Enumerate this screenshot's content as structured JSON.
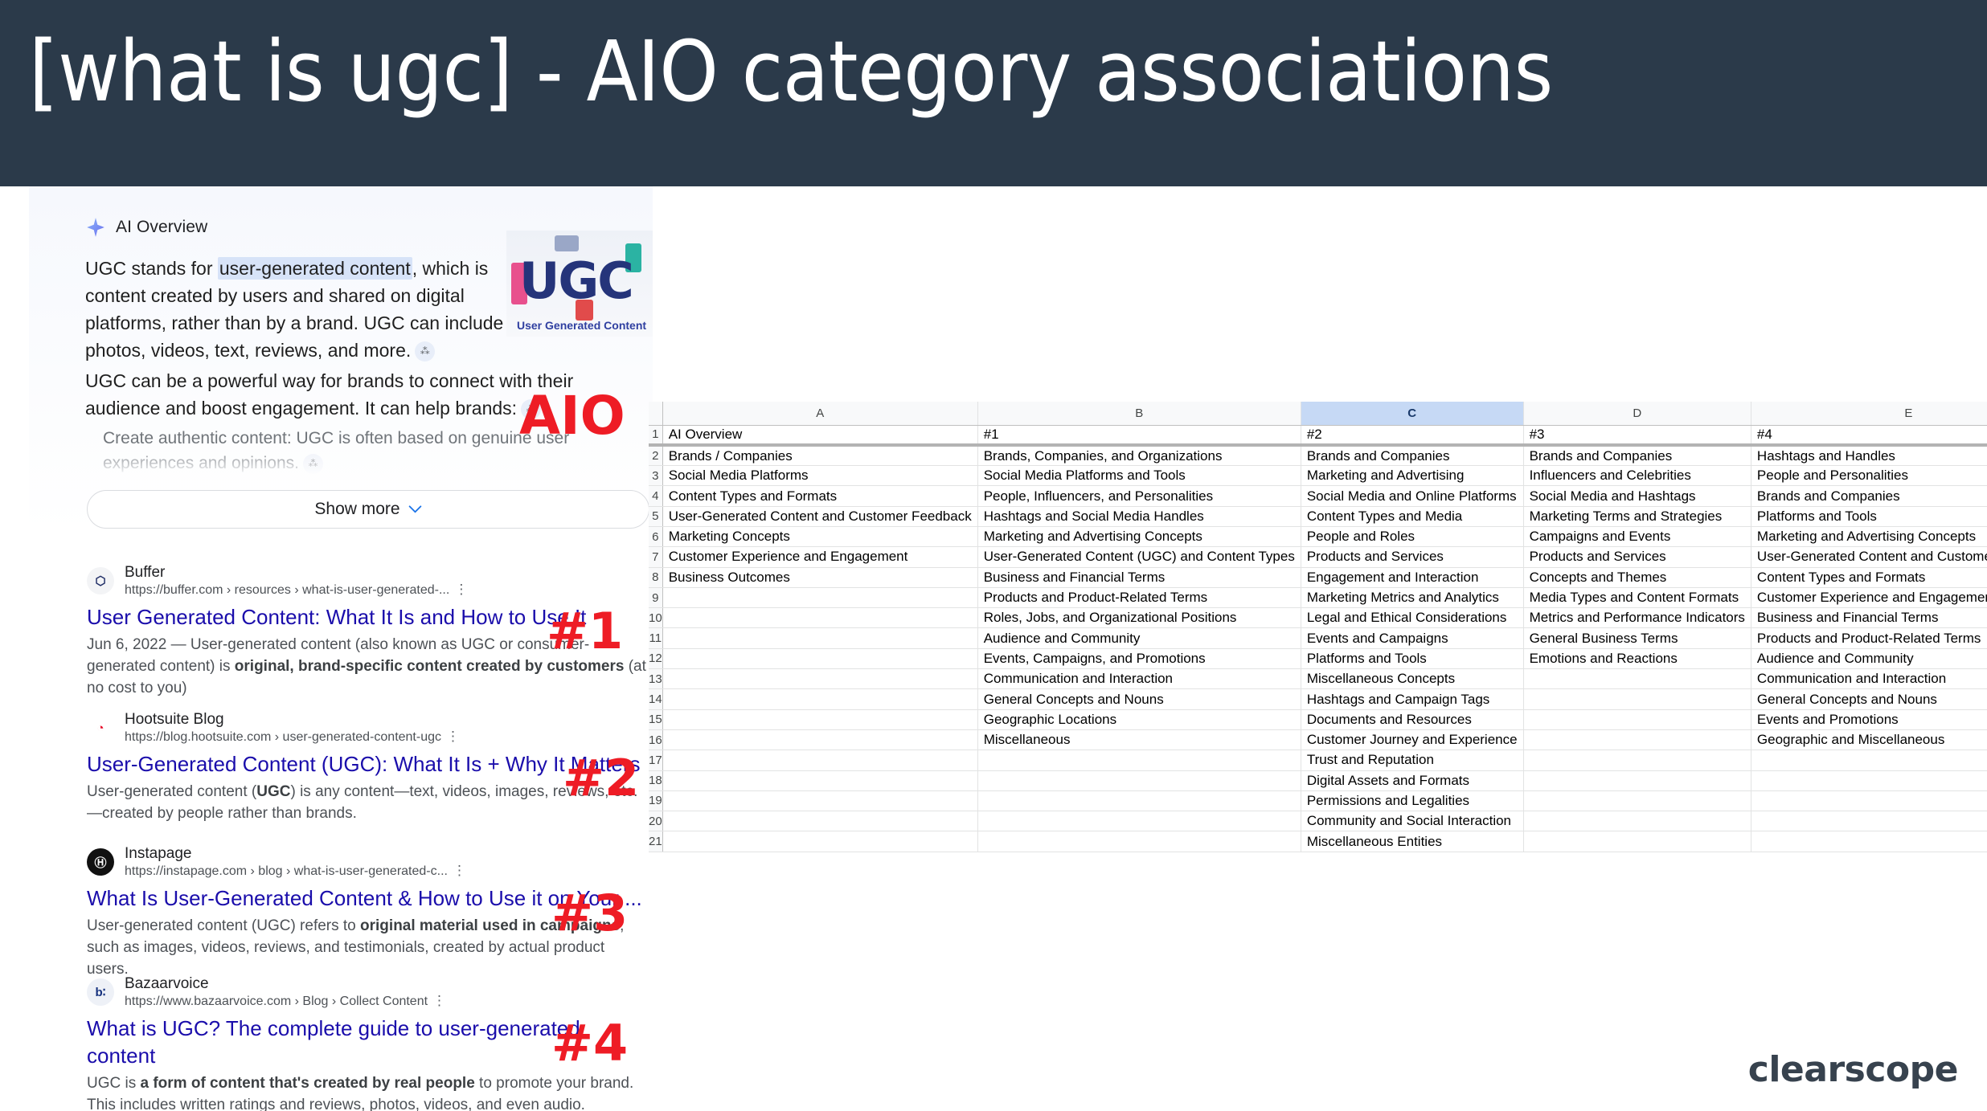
{
  "slide": {
    "title": "[what is ugc] - AIO category associations",
    "brand": "clearscope",
    "header_bg": "#2b3a4a",
    "annotation_color": "#ee1c25"
  },
  "annotations": {
    "aio": "AIO",
    "rank_1": "#1",
    "rank_2": "#2",
    "rank_3": "#3",
    "rank_4": "#4"
  },
  "serp": {
    "ai_overview": {
      "label": "AI Overview",
      "paragraph_1_pre": "UGC stands for ",
      "paragraph_1_highlight": "user-generated content",
      "paragraph_1_post": ", which is content created by users and shared on digital platforms, rather than by a brand. UGC can include photos, videos, text, reviews, and more.",
      "paragraph_2": "UGC can be a powerful way for brands to connect with their audience and boost engagement. It can help brands:",
      "bullet_1": "Create authentic content: UGC is often based on genuine user experiences and opinions.",
      "show_more_label": "Show more",
      "image_word": "UGC",
      "image_caption": "User Generated Content",
      "cite_glyph": "⁂"
    },
    "results": [
      {
        "site": "Buffer",
        "favicon_text": "⬡",
        "url": "https://buffer.com › resources › what-is-user-generated-...",
        "title": "User Generated Content: What It Is and How to Use It",
        "snippet_pre": "Jun 6, 2022 — User-generated content (also known as UGC or consumer-generated content) is ",
        "snippet_bold": "original, brand-specific content created by customers",
        "snippet_post": " (at no cost to you)"
      },
      {
        "site": "Hootsuite Blog",
        "favicon_text": "◔",
        "url": "https://blog.hootsuite.com › user-generated-content-ugc",
        "title": "User-Generated Content (UGC): What It Is + Why It Matters",
        "snippet_pre": "User-generated content (",
        "snippet_bold": "UGC",
        "snippet_post": ") is any content—text, videos, images, reviews, etc.—created by people rather than brands."
      },
      {
        "site": "Instapage",
        "favicon_text": "Ⓗ",
        "url": "https://instapage.com › blog › what-is-user-generated-c...",
        "title": "What Is User-Generated Content & How to Use it on Your ...",
        "snippet_pre": "User-generated content (UGC) refers to ",
        "snippet_bold": "original material used in campaigns",
        "snippet_post": ", such as images, videos, reviews, and testimonials, created by actual product users."
      },
      {
        "site": "Bazaarvoice",
        "favicon_text": "b∶",
        "url": "https://www.bazaarvoice.com › Blog › Collect Content",
        "title": "What is UGC? The complete guide to user-generated content",
        "snippet_pre": "UGC is ",
        "snippet_bold": "a form of content that's created by real people",
        "snippet_post": " to promote your brand. This includes written ratings and reviews, photos, videos, and even audio."
      }
    ],
    "kebab_glyph": "⋮"
  },
  "spreadsheet": {
    "column_letters": [
      "A",
      "B",
      "C",
      "D",
      "E"
    ],
    "selected_column": "C",
    "row_numbers": [
      1,
      2,
      3,
      4,
      5,
      6,
      7,
      8,
      9,
      10,
      11,
      12,
      13,
      14,
      15,
      16,
      17,
      18,
      19,
      20,
      21
    ],
    "header_row": [
      "AI Overview",
      "#1",
      "#2",
      "#3",
      "#4"
    ],
    "rows": [
      [
        "Brands / Companies",
        "Brands, Companies, and Organizations",
        "Brands and Companies",
        "Brands and Companies",
        "Hashtags and Handles"
      ],
      [
        "Social Media Platforms",
        "Social Media Platforms and Tools",
        "Marketing and Advertising",
        "Influencers and Celebrities",
        "People and Personalities"
      ],
      [
        "Content Types and Formats",
        "People, Influencers, and Personalities",
        "Social Media and Online Platforms",
        "Social Media and Hashtags",
        "Brands and Companies"
      ],
      [
        "User-Generated Content and Customer Feedback",
        "Hashtags and Social Media Handles",
        "Content Types and Media",
        "Marketing Terms and Strategies",
        "Platforms and Tools"
      ],
      [
        "Marketing Concepts",
        "Marketing and Advertising Concepts",
        "People and Roles",
        "Campaigns and Events",
        "Marketing and Advertising Concepts"
      ],
      [
        "Customer Experience and Engagement",
        "User-Generated Content (UGC) and Content Types",
        "Products and Services",
        "Products and Services",
        "User-Generated Content and Customer Feedback"
      ],
      [
        "Business Outcomes",
        "Business and Financial Terms",
        "Engagement and Interaction",
        "Concepts and Themes",
        "Content Types and Formats"
      ],
      [
        "",
        "Products and Product-Related Terms",
        "Marketing Metrics and Analytics",
        "Media Types and Content Formats",
        "Customer Experience and Engagement"
      ],
      [
        "",
        "Roles, Jobs, and Organizational Positions",
        "Legal and Ethical Considerations",
        "Metrics and Performance Indicators",
        "Business and Financial Terms"
      ],
      [
        "",
        "Audience and Community",
        "Events and Campaigns",
        "General Business Terms",
        "Products and Product-Related Terms"
      ],
      [
        "",
        "Events, Campaigns, and Promotions",
        "Platforms and Tools",
        "Emotions and Reactions",
        "Audience and Community"
      ],
      [
        "",
        "Communication and Interaction",
        "Miscellaneous Concepts",
        "",
        "Communication and Interaction"
      ],
      [
        "",
        "General Concepts and Nouns",
        "Hashtags and Campaign Tags",
        "",
        "General Concepts and Nouns"
      ],
      [
        "",
        "Geographic Locations",
        "Documents and Resources",
        "",
        "Events and Promotions"
      ],
      [
        "",
        "Miscellaneous",
        "Customer Journey and Experience",
        "",
        "Geographic and Miscellaneous"
      ],
      [
        "",
        "",
        "Trust and Reputation",
        "",
        ""
      ],
      [
        "",
        "",
        "Digital Assets and Formats",
        "",
        ""
      ],
      [
        "",
        "",
        "Permissions and Legalities",
        "",
        ""
      ],
      [
        "",
        "",
        "Community and Social Interaction",
        "",
        ""
      ],
      [
        "",
        "",
        "Miscellaneous Entities",
        "",
        ""
      ]
    ]
  }
}
